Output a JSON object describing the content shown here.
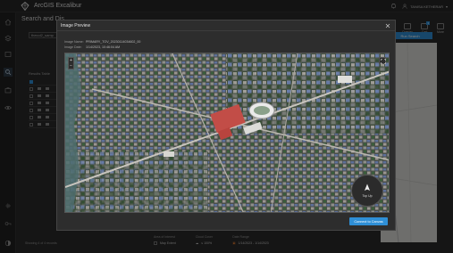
{
  "app": {
    "title": "ArcGIS Excalibur"
  },
  "user": {
    "name": "TANISA KETHERAR"
  },
  "panel": {
    "title": "Search and Dis",
    "tab_label": "thecol2_samp",
    "results_label": "Results Table",
    "showing_text": "Showing 4 of 4 records"
  },
  "toolbar": {
    "overlay_label": "Overlay",
    "cart_label": "Cart",
    "more_label": "More",
    "cart_count": "1",
    "run_search_label": "Run Search"
  },
  "bottom_stats": [
    {
      "label": "Area of Interest",
      "value": "Map Extent"
    },
    {
      "label": "Cloud Cover",
      "value": "≤ 100%"
    },
    {
      "label": "Date Range",
      "value": "1/14/2023 - 1/14/2023"
    }
  ],
  "modal": {
    "title": "Image Preview",
    "image_name_label": "Image Name:",
    "image_name": "PRIMARY_TOV_20230114034602_00",
    "image_date_label": "Image Date:",
    "image_date": "1/14/2023, 10:46:04 AM",
    "zoom_in": "+",
    "zoom_out": "−",
    "compass_label": "Top Up",
    "connect_label": "Connect to Canvas"
  },
  "colors": {
    "accent": "#2f8fd6",
    "background": "#1a1a1a",
    "panel": "#2d2d2d"
  }
}
